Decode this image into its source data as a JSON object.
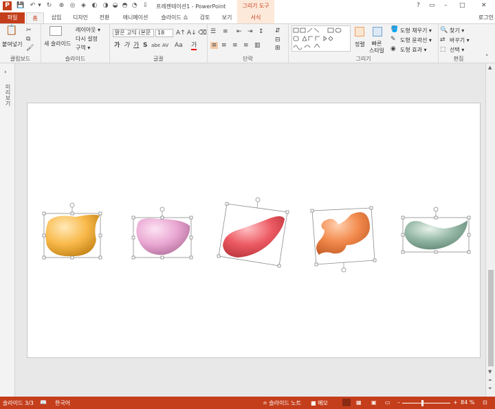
{
  "app": {
    "logo": "P",
    "title": "프레젠테이션1 - PowerPoint",
    "context_tab": "그리기 도구",
    "login": "로그인"
  },
  "quick_access": [
    "save-icon",
    "undo-icon",
    "undo-dropdown-icon",
    "redo-icon",
    "shape-rotate-icon",
    "shape-merge-icon",
    "shape-group-icon",
    "shape-union-icon",
    "shape-combine-icon",
    "shape-fragment-icon",
    "shape-intersect-icon",
    "shape-subtract-icon",
    "customize-qat-icon"
  ],
  "window": {
    "help": "?",
    "restore": "▭",
    "minimize": "–",
    "maximize": "□",
    "close": "✕"
  },
  "tabs": [
    "파일",
    "홈",
    "삽입",
    "디자인",
    "전환",
    "애니메이션",
    "슬라이드 쇼",
    "검토",
    "보기",
    "서식"
  ],
  "ribbon": {
    "clipboard": {
      "label": "클립보드",
      "paste": "붙여넣기"
    },
    "slides": {
      "label": "슬라이드",
      "new_slide": "새 슬라이드",
      "layout": "레이아웃 ▾",
      "reset": "다시 설정",
      "section": "구역 ▾"
    },
    "font": {
      "label": "글꼴",
      "font_name": "맑은 고딕 (본문",
      "font_size": "18",
      "bold": "가",
      "italic": "가",
      "underline": "가",
      "strike": "S",
      "abc": "abe",
      "spacing": "AV",
      "case": "Aa",
      "color": "가"
    },
    "paragraph": {
      "label": "단락"
    },
    "drawing": {
      "label": "그리기",
      "arrange": "정렬",
      "quick_styles": "빠른 스타일",
      "fill": "도형 채우기 ▾",
      "outline": "도형 윤곽선 ▾",
      "effects": "도형 효과 ▾"
    },
    "editing": {
      "label": "편집",
      "find": "찾기 ▾",
      "replace": "바꾸기 ▾",
      "select": "선택 ▾"
    }
  },
  "left_pane": {
    "label": "미리보기"
  },
  "shapes": [
    {
      "name": "yellow-blob",
      "fill": "#f9b94a"
    },
    {
      "name": "pink-blob",
      "fill": "#e9a7d2"
    },
    {
      "name": "red-blob",
      "fill": "#ec5a62"
    },
    {
      "name": "orange-blob",
      "fill": "#f28a4d"
    },
    {
      "name": "green-blob",
      "fill": "#93b6a4"
    }
  ],
  "status": {
    "slide": "슬라이드 3/3",
    "language": "한국어",
    "notes": "≐ 슬라이드 노트",
    "comments": "■ 메모",
    "zoom_minus": "–",
    "zoom_plus": "+",
    "zoom": "84 %"
  },
  "zoom_level": 0.84
}
